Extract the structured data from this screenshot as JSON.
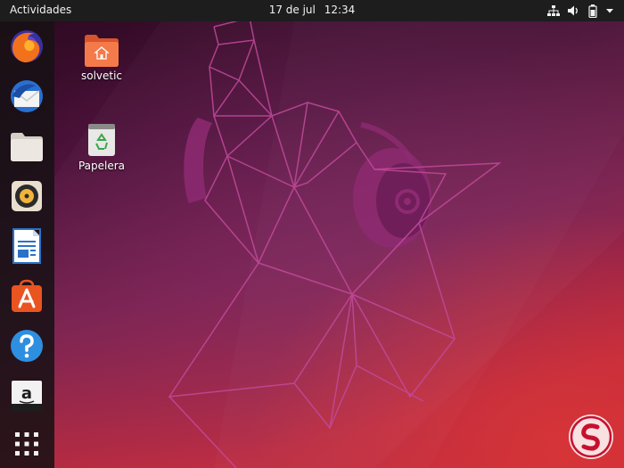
{
  "topbar": {
    "activities_label": "Actividades",
    "date": "17 de jul",
    "time": "12:34",
    "tray_icons": [
      "network-icon",
      "volume-icon",
      "battery-icon",
      "system-menu-arrow-icon"
    ]
  },
  "dock": {
    "apps": [
      {
        "name": "firefox-icon"
      },
      {
        "name": "thunderbird-icon"
      },
      {
        "name": "files-icon"
      },
      {
        "name": "rhythmbox-icon"
      },
      {
        "name": "libreoffice-writer-icon"
      },
      {
        "name": "ubuntu-software-icon"
      },
      {
        "name": "help-icon"
      },
      {
        "name": "amazon-icon"
      },
      {
        "name": "show-applications-icon"
      }
    ]
  },
  "desktop": {
    "icons": [
      {
        "label": "solvetic",
        "icon": "home-folder-icon"
      },
      {
        "label": "Papelera",
        "icon": "trash-icon"
      }
    ]
  },
  "colors": {
    "topbar_bg": "#1d1d1d",
    "wallpaper_top": "#2c0a22",
    "wallpaper_mid": "#6a1c4a",
    "wallpaper_bottom": "#c12a3a",
    "wallpaper_lines": "#c84a9a",
    "folder_orange": "#f0704a"
  },
  "watermark": {
    "icon": "solvetic-logo-icon"
  }
}
